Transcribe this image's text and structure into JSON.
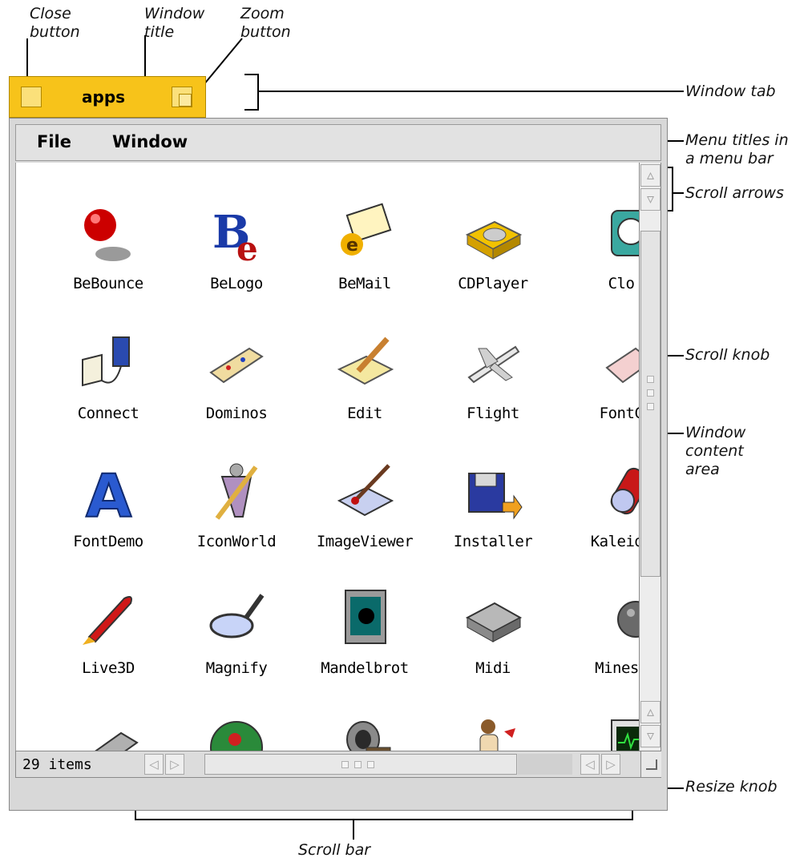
{
  "callouts": {
    "close_button": "Close\nbutton",
    "window_title": "Window\ntitle",
    "zoom_button": "Zoom\nbutton",
    "window_tab": "Window tab",
    "menu_titles": "Menu titles in\na menu bar",
    "scroll_arrows": "Scroll arrows",
    "scroll_knob": "Scroll knob",
    "window_content": "Window\ncontent\narea",
    "resize_knob": "Resize knob",
    "scroll_bar": "Scroll bar"
  },
  "window": {
    "title": "apps",
    "menu": [
      "File",
      "Window"
    ],
    "status": "29 items"
  },
  "apps": [
    "BeBounce",
    "BeLogo",
    "BeMail",
    "CDPlayer",
    "Clo",
    "Connect",
    "Dominos",
    "Edit",
    "Flight",
    "FontC",
    "FontDemo",
    "IconWorld",
    "ImageViewer",
    "Installer",
    "Kaleido",
    "Live3D",
    "Magnify",
    "Mandelbrot",
    "Midi",
    "Minesw",
    "",
    "",
    "",
    "",
    ""
  ],
  "colors": {
    "tab": "#f7c31a",
    "frame": "#d8d8d8",
    "content": "#ffffff"
  },
  "icons": {
    "scroll_up": "▵",
    "scroll_down": "▿",
    "scroll_left": "◁",
    "scroll_right": "▷"
  }
}
